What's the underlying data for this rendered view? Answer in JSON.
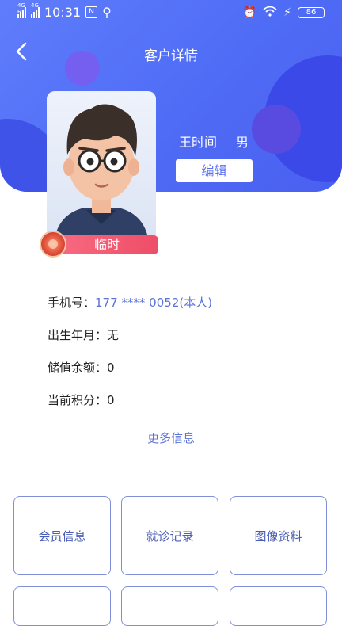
{
  "status": {
    "time": "10:31",
    "net1": "4G HD",
    "net2": "4G",
    "battery": "86"
  },
  "header": {
    "title": "客户详情",
    "back_icon": "chevron-left-icon"
  },
  "profile": {
    "name": "王时间",
    "gender": "男",
    "edit_label": "编辑",
    "badge": "临时"
  },
  "info": [
    {
      "label": "手机号：",
      "value": "177 **** 0052(本人)"
    },
    {
      "label": "出生年月：",
      "value": "无"
    },
    {
      "label": "储值余额：",
      "value": "0"
    },
    {
      "label": "当前积分：",
      "value": "0"
    }
  ],
  "more_label": "更多信息",
  "tiles": [
    {
      "label": "会员信息"
    },
    {
      "label": "就诊记录"
    },
    {
      "label": "图像资料"
    }
  ],
  "colors": {
    "accent": "#4f6cf6",
    "tile_border": "#7f90d8",
    "link": "#5b72d6",
    "badge": "#ef4d67"
  }
}
